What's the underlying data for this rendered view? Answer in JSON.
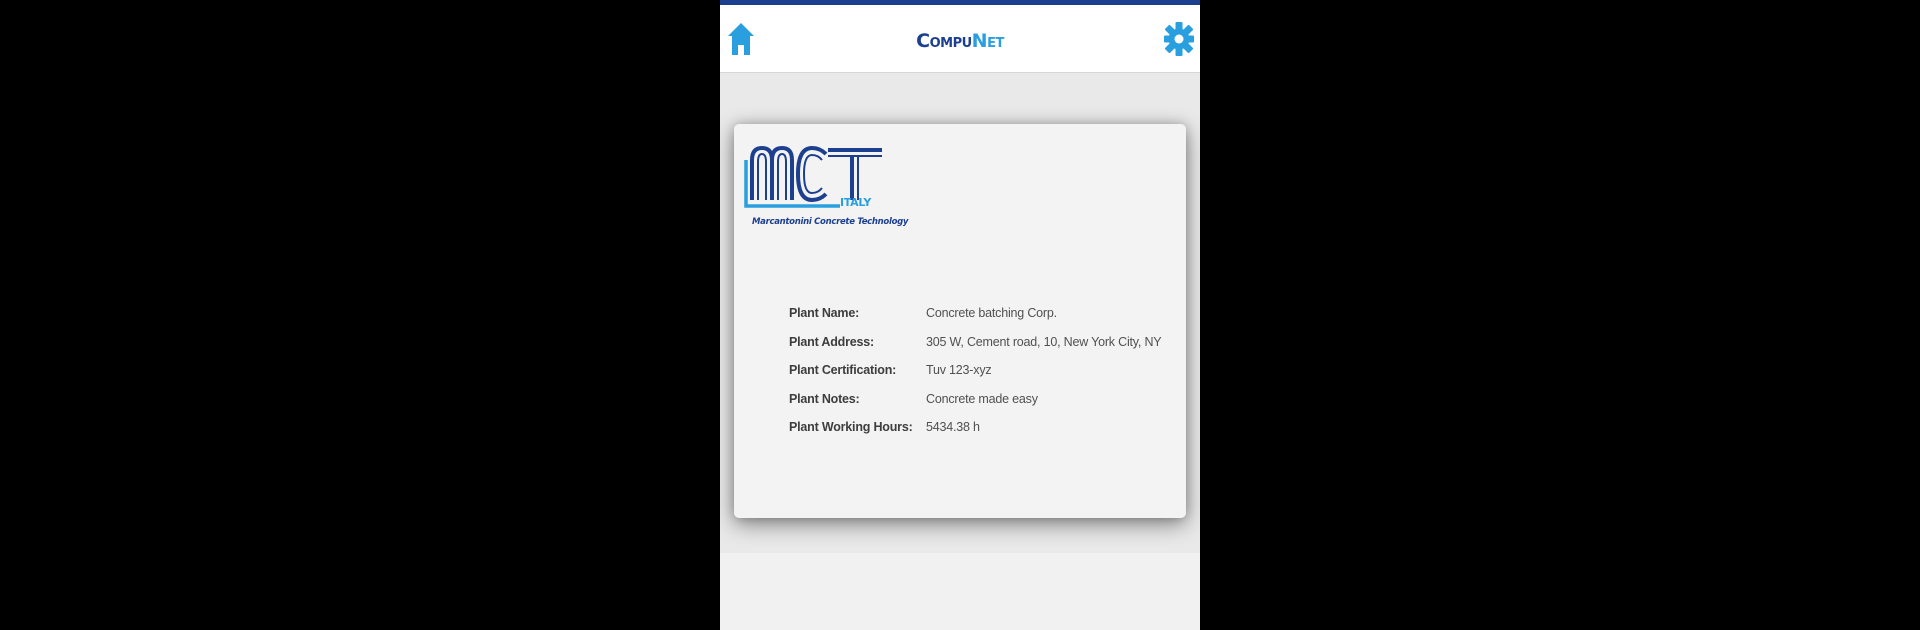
{
  "header": {
    "brand_part1": "Compu",
    "brand_part2": "Net",
    "home_icon": "home-icon",
    "settings_icon": "gear-icon"
  },
  "logo": {
    "letters": "MCT",
    "country": "ITALY",
    "caption": "Marcantonini Concrete Technology"
  },
  "plant_info": [
    {
      "label": "Plant Name:",
      "value": "Concrete batching Corp."
    },
    {
      "label": "Plant Address:",
      "value": "305 W, Cement road, 10, New York City, NY"
    },
    {
      "label": "Plant Certification:",
      "value": "Tuv 123-xyz"
    },
    {
      "label": "Plant Notes:",
      "value": "Concrete made easy"
    },
    {
      "label": "Plant Working Hours:",
      "value": "5434.38 h"
    }
  ],
  "colors": {
    "accent_blue": "#2a9fe0",
    "brand_navy": "#1d3f8f",
    "top_bar": "#1d3f8f"
  }
}
